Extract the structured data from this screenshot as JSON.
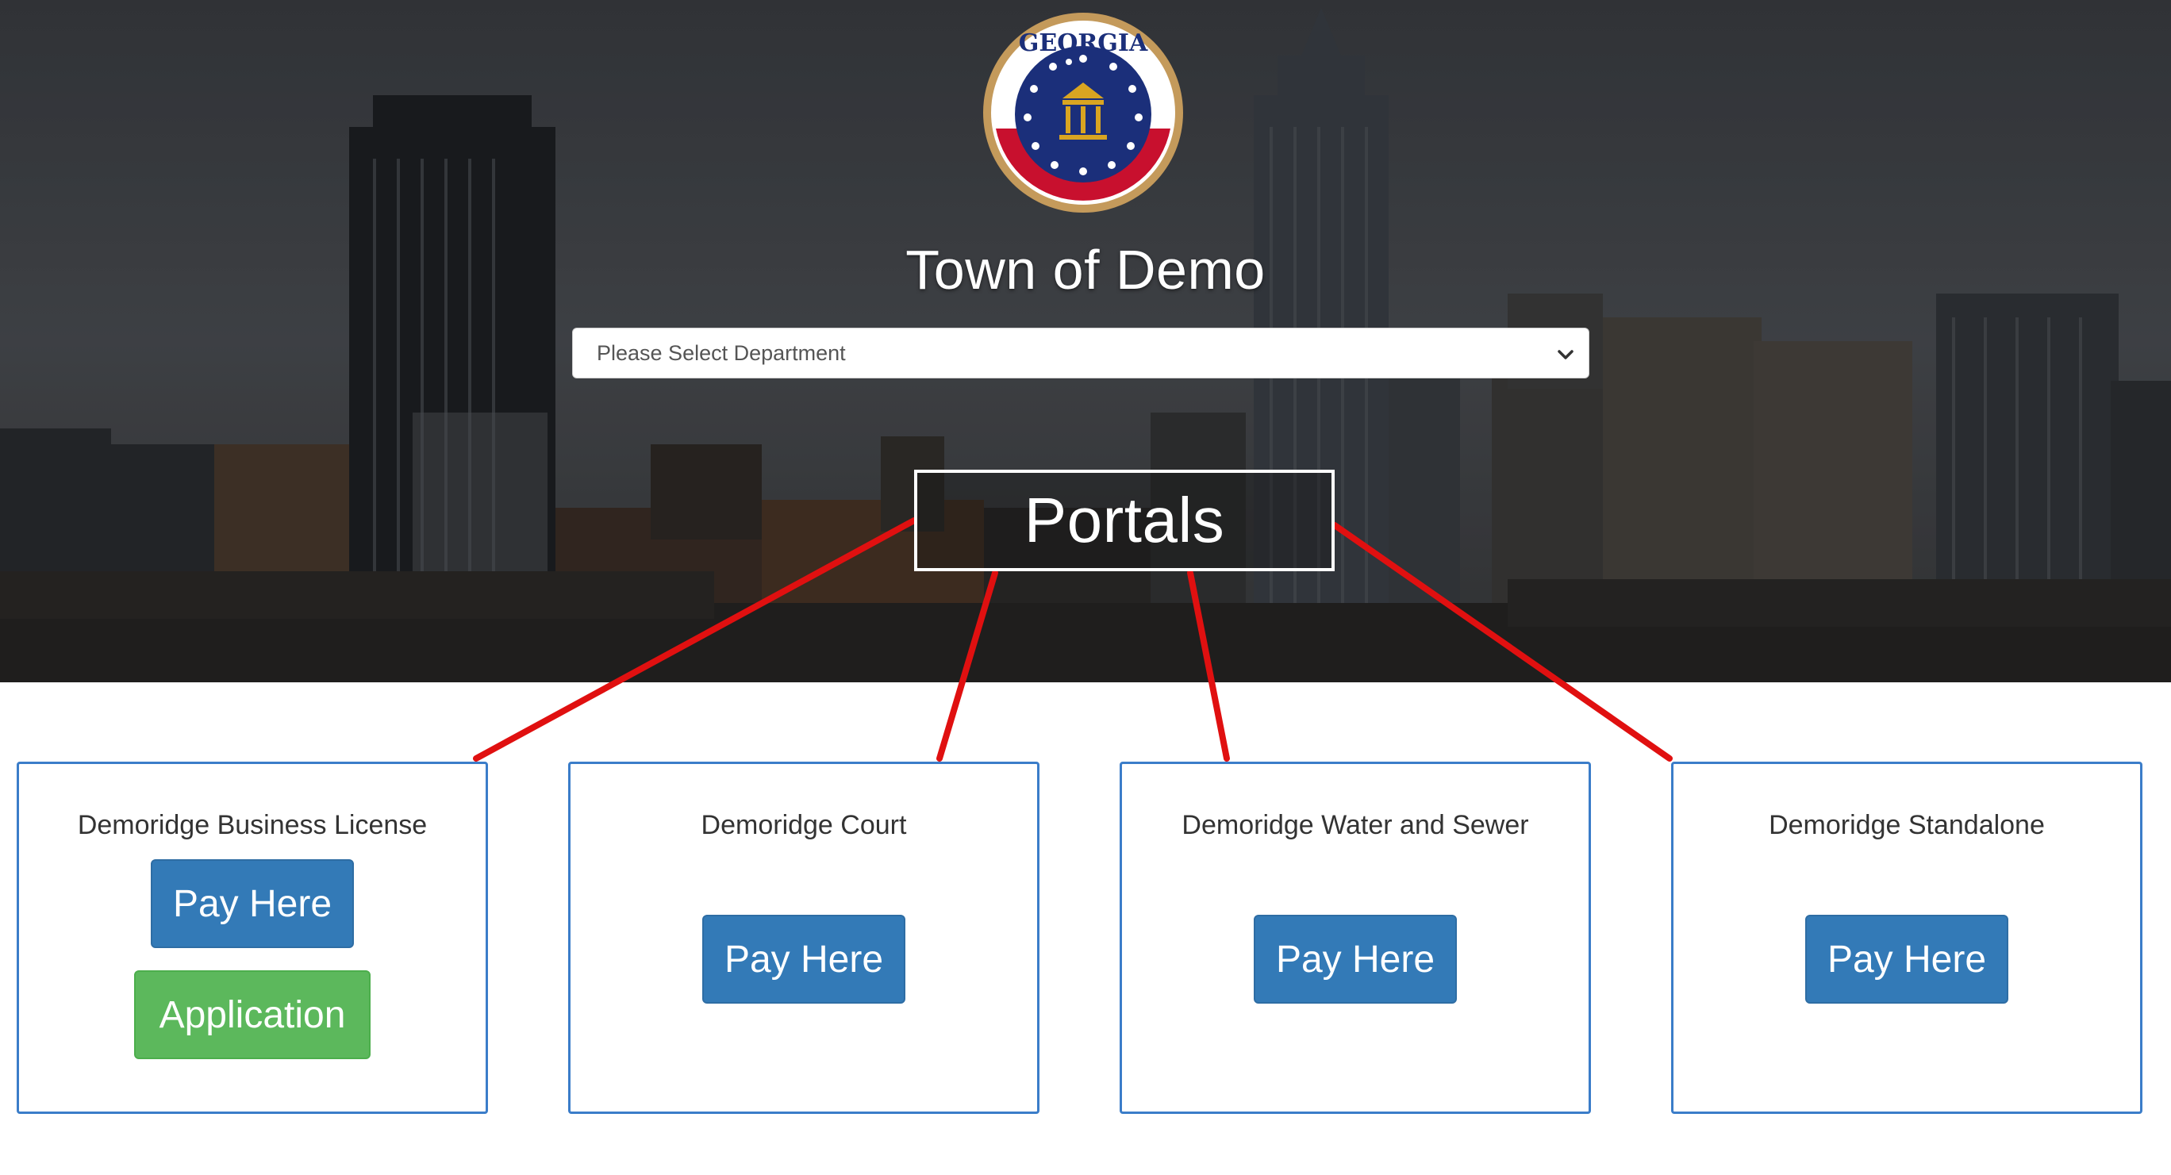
{
  "header": {
    "seal_text": "GEORGIA",
    "town_title": "Town of Demo",
    "department_select": {
      "selected": "Please Select Department"
    }
  },
  "annotation": {
    "label": "Portals",
    "color": "#e01010"
  },
  "portals": [
    {
      "title": "Demoridge Business License",
      "pay_label": "Pay Here",
      "application_label": "Application"
    },
    {
      "title": "Demoridge Court",
      "pay_label": "Pay Here"
    },
    {
      "title": "Demoridge Water and Sewer",
      "pay_label": "Pay Here"
    },
    {
      "title": "Demoridge Standalone",
      "pay_label": "Pay Here"
    }
  ],
  "colors": {
    "primary_button": "#337ab7",
    "success_button": "#5cb85c",
    "card_border": "#3b7dc9"
  },
  "icons": [
    "georgia-seal",
    "chevron-down-icon"
  ]
}
